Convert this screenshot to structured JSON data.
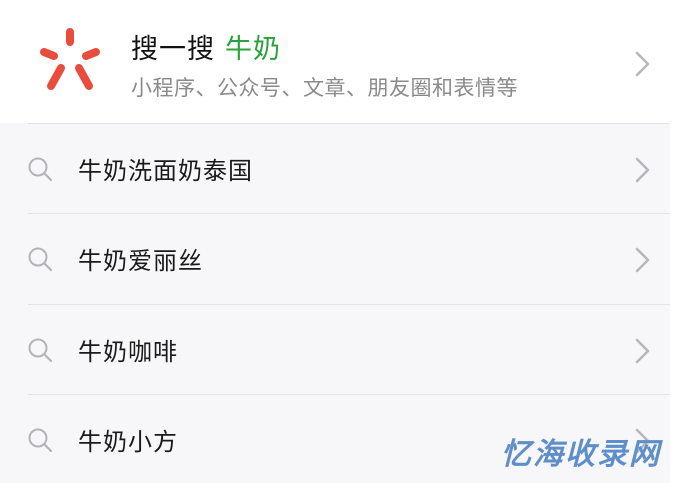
{
  "header": {
    "title": "搜一搜",
    "keyword": "牛奶",
    "subtitle": "小程序、公众号、文章、朋友圈和表情等",
    "logo_icon": "weixin-search-logo-icon",
    "logo_color": "#e84c3d",
    "keyword_color": "#2aa23a"
  },
  "suggestions": [
    {
      "label": "牛奶洗面奶泰国",
      "icon": "search-icon"
    },
    {
      "label": "牛奶爱丽丝",
      "icon": "search-icon"
    },
    {
      "label": "牛奶咖啡",
      "icon": "search-icon"
    },
    {
      "label": "牛奶小方",
      "icon": "search-icon"
    }
  ],
  "watermark": "忆海收录网",
  "watermark_color": "#5f8fc9"
}
